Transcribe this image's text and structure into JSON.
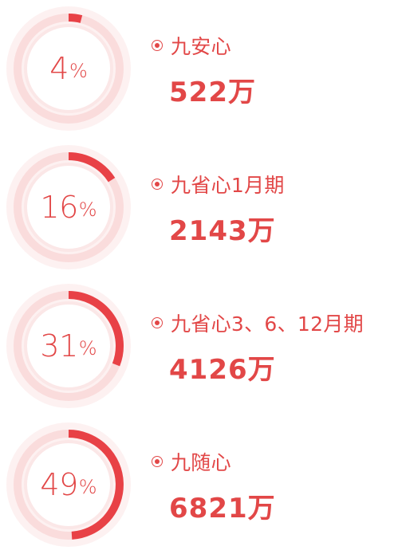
{
  "chart_data": {
    "type": "pie",
    "items": [
      {
        "label": "九安心",
        "percent": 4,
        "percent_text": "4",
        "unit": "%",
        "amount": "522万"
      },
      {
        "label": "九省心1月期",
        "percent": 16,
        "percent_text": "16",
        "unit": "%",
        "amount": "2143万"
      },
      {
        "label": "九省心3、6、12月期",
        "percent": 31,
        "percent_text": "31",
        "unit": "%",
        "amount": "4126万"
      },
      {
        "label": "九随心",
        "percent": 49,
        "percent_text": "49",
        "unit": "%",
        "amount": "6821万"
      }
    ],
    "colors": {
      "accent": "#e84146",
      "track": "#fadcdc",
      "halo": "#fdf1f1",
      "inner_ring": "#fbe7e7",
      "text": "#e24747"
    }
  }
}
